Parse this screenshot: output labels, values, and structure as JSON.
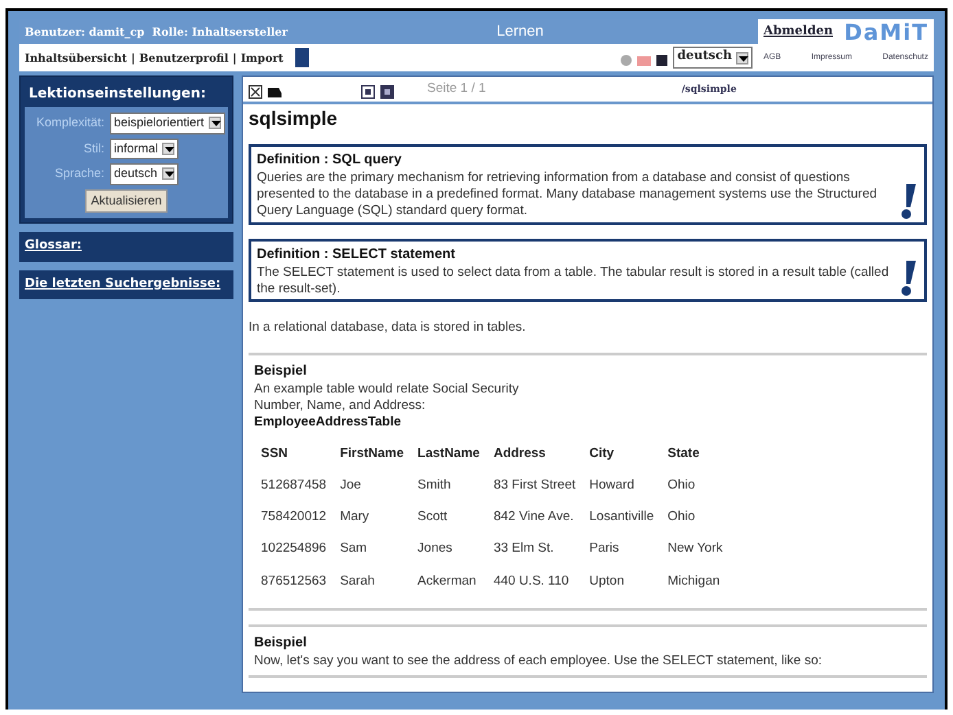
{
  "header": {
    "user": "Benutzer: damit_cp",
    "role": "Rolle: Inhaltsersteller",
    "title": "Lernen",
    "logout": "Abmelden",
    "logo": "DaMiT",
    "footer_links": [
      "AGB",
      "Impressum",
      "Datenschutz"
    ]
  },
  "nav": {
    "links": [
      "Inhaltsübersicht",
      "Benutzerprofil",
      "Import"
    ],
    "separator": "|",
    "language": "deutsch"
  },
  "sidebar": {
    "heading": "Lektionseinstellungen:",
    "settings": [
      {
        "label": "Komplexität:",
        "value": "beispielorientiert"
      },
      {
        "label": "Stil:",
        "value": "informal"
      },
      {
        "label": "Sprache:",
        "value": "deutsch"
      }
    ],
    "button": "Aktualisieren",
    "links": [
      "Glossar:",
      "Die letzten Suchergebnisse:"
    ]
  },
  "content": {
    "page": "Seite 1 / 1",
    "path": "/sqlsimple",
    "title": "sqlsimple",
    "definitions": [
      {
        "title": "Definition : SQL query",
        "text": "Queries are the primary mechanism for retrieving information from a database and consist of questions presented to the database in a predefined format. Many database management systems use the Structured Query Language (SQL) standard query format."
      },
      {
        "title": "Definition : SELECT statement",
        "text": "The SELECT statement is used to select data from a table. The tabular result is stored in a result table (called the result-set)."
      }
    ],
    "paragraph": "In a relational database, data is stored in tables.",
    "examples": [
      {
        "title": "Beispiel",
        "text": "An example table would relate Social Security\nNumber, Name, and Address:",
        "table_name": "EmployeeAddressTable",
        "table": {
          "columns": [
            "SSN",
            "FirstName",
            "LastName",
            "Address",
            "City",
            "State"
          ],
          "rows": [
            [
              "512687458",
              "Joe",
              "Smith",
              "83 First Street",
              "Howard",
              "Ohio"
            ],
            [
              "758420012",
              "Mary",
              "Scott",
              "842 Vine Ave.",
              "Losantiville",
              "Ohio"
            ],
            [
              "102254896",
              "Sam",
              "Jones",
              "33 Elm St.",
              "Paris",
              "New York"
            ],
            [
              "876512563",
              "Sarah",
              "Ackerman",
              "440 U.S. 110",
              "Upton",
              "Michigan"
            ]
          ]
        }
      },
      {
        "title": "Beispiel",
        "text": "Now, let's say you want to see the address of each employee. Use the SELECT statement, like so:"
      }
    ]
  }
}
